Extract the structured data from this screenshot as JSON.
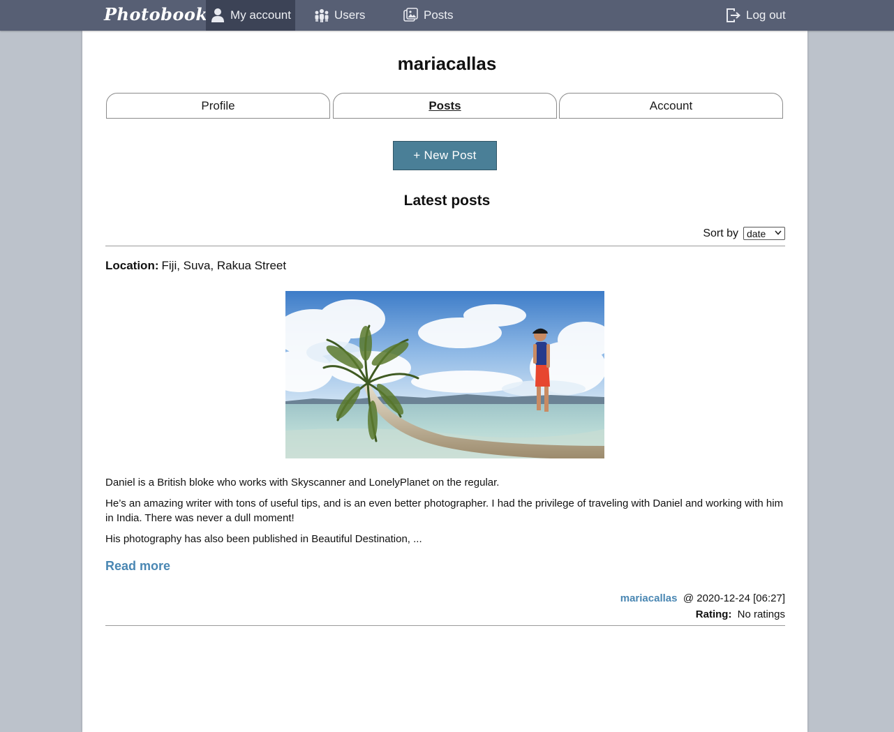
{
  "navbar": {
    "brand": "Photobook",
    "my_account": "My account",
    "users": "Users",
    "posts": "Posts",
    "logout": "Log out"
  },
  "profile": {
    "username": "mariacallas"
  },
  "tabs": [
    {
      "label": "Profile",
      "active": false
    },
    {
      "label": "Posts",
      "active": true
    },
    {
      "label": "Account",
      "active": false
    }
  ],
  "new_post_label": "+ New Post",
  "latest_posts_title": "Latest posts",
  "sort": {
    "label": "Sort by",
    "selected": "date"
  },
  "post": {
    "location_label": "Location:",
    "location": "Fiji, Suva, Rakua Street",
    "paragraphs": [
      "Daniel is a British bloke who works with Skyscanner and LonelyPlanet on the regular.",
      "He’s an amazing writer with tons of useful tips, and is an even better photographer. I had the privilege of traveling with Daniel and working with him in India. There was never a dull moment!",
      "His photography has also been published in Beautiful Destination, ..."
    ],
    "read_more": "Read more",
    "author": "mariacallas",
    "date": "@ 2020-12-24 [06:27]",
    "rating_label": "Rating:",
    "rating": "No ratings"
  },
  "colors": {
    "navbar": "#575f74",
    "navbar_active": "#3c4356",
    "page_bg": "#bcc2cb",
    "button": "#4a7f97",
    "link": "#4a87b3"
  }
}
